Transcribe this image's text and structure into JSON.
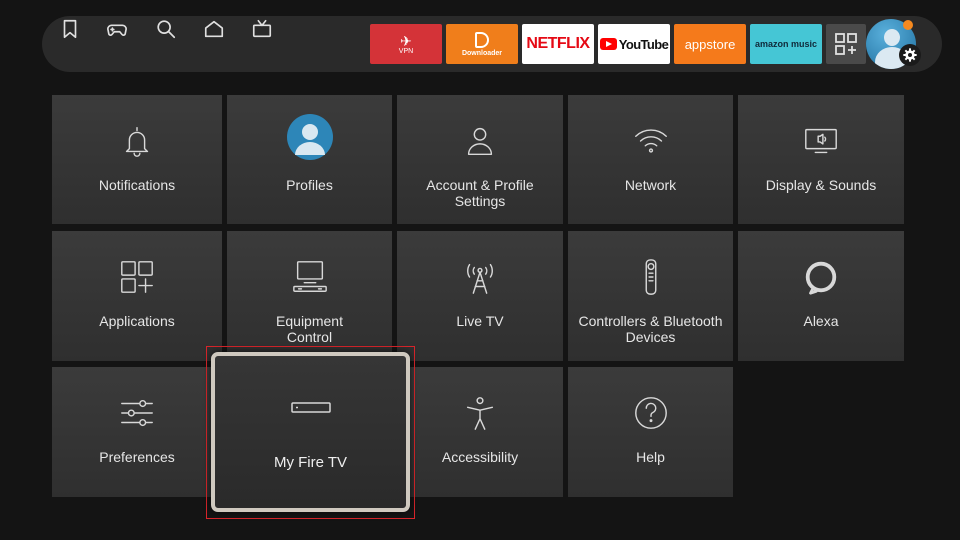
{
  "nav": {
    "icons": [
      "bookmark-icon",
      "gamepad-icon",
      "search-icon",
      "home-icon",
      "live-tv-icon"
    ],
    "apps": {
      "vpn_label": "VPN",
      "downloader_label": "Downloader",
      "netflix_label": "NETFLIX",
      "youtube_label": "YouTube",
      "appstore_label": "appstore",
      "amazon_music_label": "amazon music"
    },
    "colors": {
      "vpn": "#d43338",
      "downloader": "#f07e1b",
      "netflix": "#e50914",
      "appstore": "#f57a1b",
      "amazon_music": "#45c6d5",
      "notification": "#f5891f"
    }
  },
  "settings": {
    "row1": [
      {
        "label": "Notifications",
        "icon": "bell-icon"
      },
      {
        "label": "Profiles",
        "icon": "profile-avatar-icon"
      },
      {
        "label": "Account & Profile\nSettings",
        "icon": "person-icon"
      },
      {
        "label": "Network",
        "icon": "wifi-icon"
      },
      {
        "label": "Display & Sounds",
        "icon": "display-sound-icon"
      }
    ],
    "row2": [
      {
        "label": "Applications",
        "icon": "apps-grid-icon"
      },
      {
        "label": "Equipment\nControl",
        "icon": "equipment-icon"
      },
      {
        "label": "Live TV",
        "icon": "antenna-icon"
      },
      {
        "label": "Controllers & Bluetooth\nDevices",
        "icon": "remote-icon"
      },
      {
        "label": "Alexa",
        "icon": "alexa-icon"
      }
    ],
    "row3": [
      {
        "label": "Preferences",
        "icon": "sliders-icon"
      },
      {
        "label": "My Fire TV",
        "icon": "fire-tv-device-icon"
      },
      {
        "label": "Accessibility",
        "icon": "accessibility-icon"
      },
      {
        "label": "Help",
        "icon": "help-icon"
      }
    ]
  }
}
